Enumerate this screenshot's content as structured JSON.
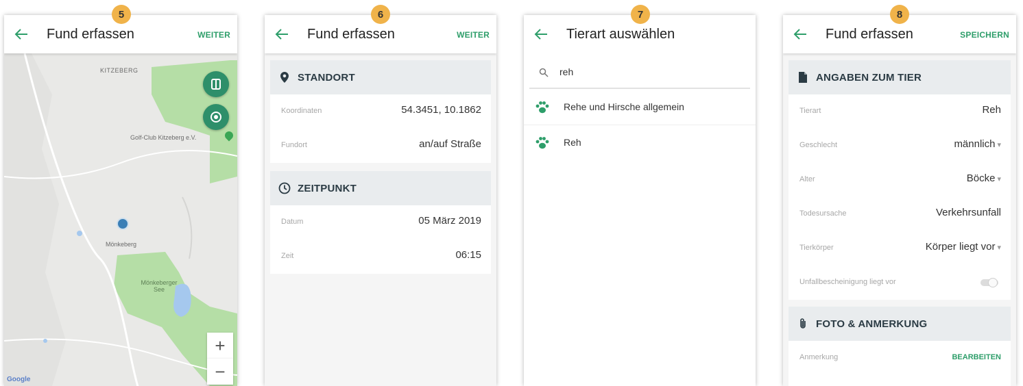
{
  "badges": [
    "5",
    "6",
    "7",
    "8"
  ],
  "colors": {
    "accent": "#2e9e6a",
    "badge": "#f0b34a",
    "map_green": "#b5dea6",
    "section_bg": "#e9ecee"
  },
  "screen1": {
    "title": "Fund erfassen",
    "action": "WEITER",
    "map": {
      "labels": {
        "kitzeberg": "KITZEBERG",
        "golf": "Golf-Club Kitzeberg e.V.",
        "moenkeberg": "Mönkeberg",
        "see": "Mönkeberger See"
      },
      "logo": "Google",
      "zoom_in": "+",
      "zoom_out": "−"
    }
  },
  "screen2": {
    "title": "Fund erfassen",
    "action": "WEITER",
    "standort": {
      "header": "STANDORT",
      "rows": [
        {
          "label": "Koordinaten",
          "value": "54.3451, 10.1862"
        },
        {
          "label": "Fundort",
          "value": "an/auf Straße"
        }
      ]
    },
    "zeitpunkt": {
      "header": "ZEITPUNKT",
      "rows": [
        {
          "label": "Datum",
          "value": "05 März 2019"
        },
        {
          "label": "Zeit",
          "value": "06:15"
        }
      ]
    }
  },
  "screen3": {
    "title": "Tierart auswählen",
    "search_value": "reh",
    "results": [
      "Rehe und Hirsche allgemein",
      "Reh"
    ]
  },
  "screen4": {
    "title": "Fund erfassen",
    "action": "SPEICHERN",
    "angaben": {
      "header": "ANGABEN ZUM TIER",
      "rows": [
        {
          "label": "Tierart",
          "value": "Reh",
          "dropdown": false
        },
        {
          "label": "Geschlecht",
          "value": "männlich",
          "dropdown": true
        },
        {
          "label": "Alter",
          "value": "Böcke",
          "dropdown": true
        },
        {
          "label": "Todesursache",
          "value": "Verkehrsunfall",
          "dropdown": false
        },
        {
          "label": "Tierkörper",
          "value": "Körper liegt vor",
          "dropdown": true
        }
      ],
      "toggle_label": "Unfallbescheinigung liegt vor",
      "toggle_on": false
    },
    "foto": {
      "header": "FOTO & ANMERKUNG",
      "rows": [
        {
          "label": "Anmerkung",
          "action": "BEARBEITEN"
        }
      ]
    }
  }
}
